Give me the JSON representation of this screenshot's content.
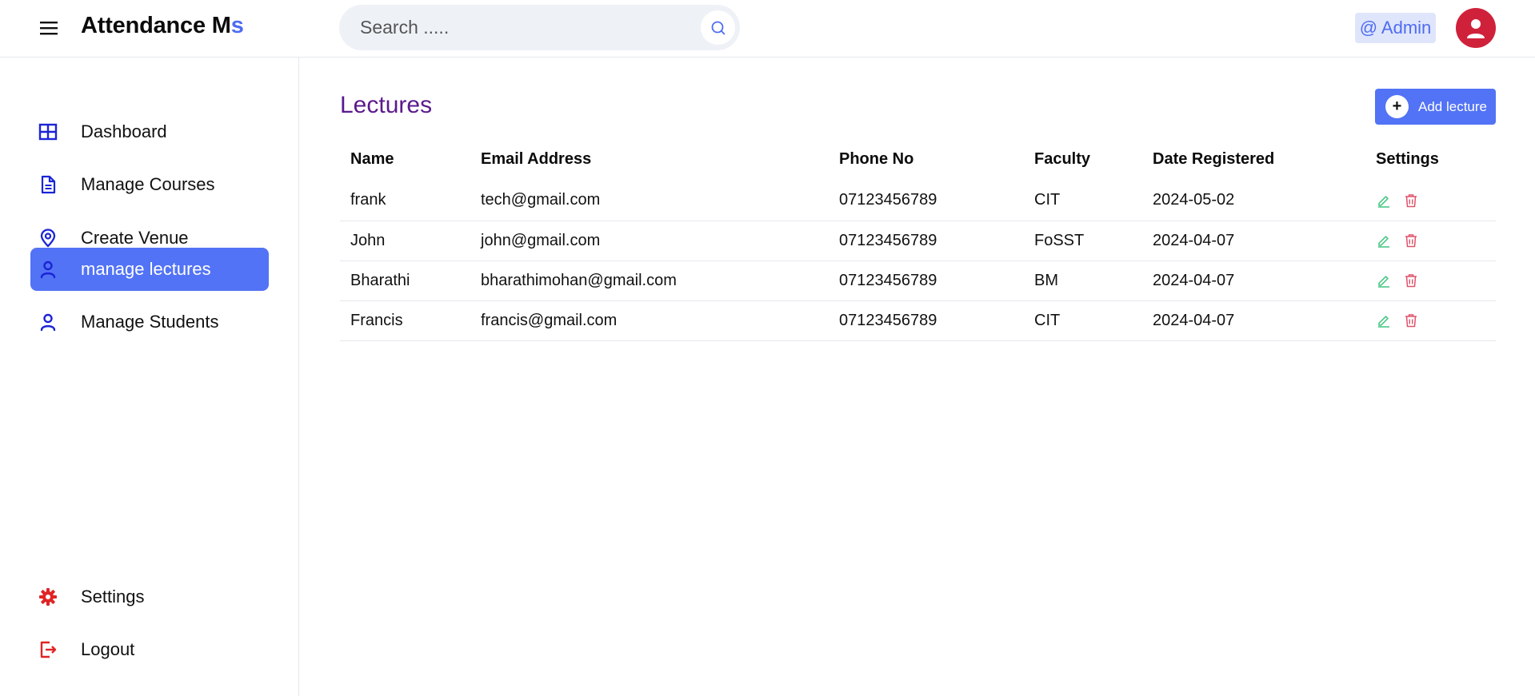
{
  "header": {
    "brand_main": "Attendance M",
    "brand_accent": "s",
    "search_placeholder": "Search .....",
    "admin_label": "@ Admin"
  },
  "sidebar": {
    "items": [
      {
        "label": "Dashboard",
        "icon": "grid-icon",
        "active": false
      },
      {
        "label": "Manage Courses",
        "icon": "document-icon",
        "active": false
      },
      {
        "label": "Create Venue",
        "icon": "location-pin-icon",
        "active": false
      },
      {
        "label": "manage lectures",
        "icon": "user-icon",
        "active": true
      },
      {
        "label": "Manage Students",
        "icon": "user-icon",
        "active": false
      }
    ],
    "bottom_items": [
      {
        "label": "Settings",
        "icon": "gear-icon"
      },
      {
        "label": "Logout",
        "icon": "logout-icon"
      }
    ]
  },
  "main": {
    "title": "Lectures",
    "add_button_label": "Add lecture",
    "table": {
      "headers": [
        "Name",
        "Email Address",
        "Phone No",
        "Faculty",
        "Date Registered",
        "Settings"
      ],
      "rows": [
        [
          "frank",
          "tech@gmail.com",
          "07123456789",
          "CIT",
          "2024-05-02"
        ],
        [
          "John",
          "john@gmail.com",
          "07123456789",
          "FoSST",
          "2024-04-07"
        ],
        [
          "Bharathi",
          "bharathimohan@gmail.com",
          "07123456789",
          "BM",
          "2024-04-07"
        ],
        [
          "Francis",
          "francis@gmail.com",
          "07123456789",
          "CIT",
          "2024-04-07"
        ]
      ]
    }
  },
  "colors": {
    "accent": "#5273f5",
    "title": "#5b1a8c",
    "edit": "#3cc47c",
    "delete": "#e0506a",
    "sidebar_icon": "#1a24d6",
    "danger_icon": "#e02424"
  }
}
